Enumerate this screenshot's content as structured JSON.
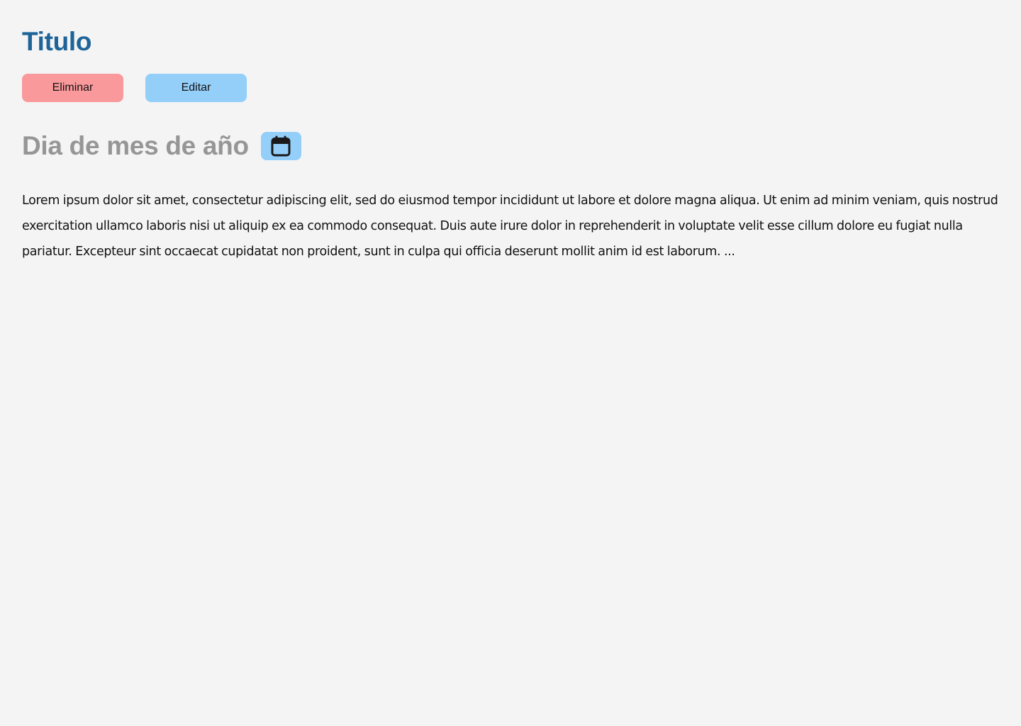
{
  "colors": {
    "background": "#f4f4f4",
    "title": "#1e6499",
    "date_text": "#969696",
    "delete_button_bg": "#fa999b",
    "edit_button_bg": "#94cffa",
    "calendar_button_bg": "#94cffa",
    "icon": "#1a1a1a"
  },
  "header": {
    "title": "Titulo"
  },
  "actions": {
    "delete_label": "Eliminar",
    "edit_label": "Editar"
  },
  "date": {
    "text": "Dia de mes de año",
    "icon": "calendar-icon"
  },
  "content": {
    "description": "Lorem ipsum dolor sit amet, consectetur adipiscing elit, sed do eiusmod tempor incididunt ut labore et dolore magna aliqua. Ut enim ad minim veniam, quis nostrud exercitation ullamco laboris nisi ut aliquip ex ea commodo consequat. Duis aute irure dolor in reprehenderit in voluptate velit esse cillum dolore eu fugiat nulla pariatur. Excepteur sint occaecat cupidatat non proident, sunt in culpa qui officia deserunt mollit anim id est laborum. ..."
  }
}
